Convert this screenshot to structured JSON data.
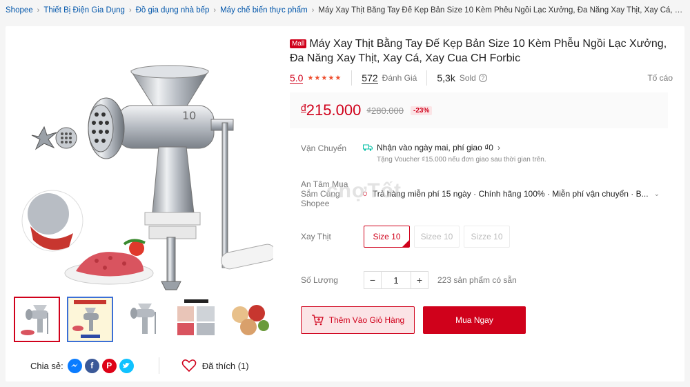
{
  "breadcrumb": {
    "items": [
      "Shopee",
      "Thiết Bị Điện Gia Dụng",
      "Đồ gia dụng nhà bếp",
      "Máy chế biến thực phẩm"
    ],
    "current": "Máy Xay Thịt Bằng Tay Đế Kẹp Bản Size 10 Kèm Phễu Ngồi Lạc Xưởng, Đa Năng Xay Thịt, Xay Cá, Xay ..."
  },
  "product": {
    "badge": "Mall",
    "title": "Máy Xay Thịt Bằng Tay Đế Kẹp Bản Size 10 Kèm Phễu Ngồi Lạc Xưởng, Đa Năng Xay Thịt, Xay Cá, Xay Cua CH Forbic",
    "rating": "5.0",
    "stars": "★★★★★",
    "reviews_count": "572",
    "reviews_label": "Đánh Giá",
    "sold_count": "5,3k",
    "sold_label": "Sold",
    "report_label": "Tố cáo",
    "currency": "đ",
    "price": "215.000",
    "old_price": "₫280.000",
    "discount": "-23%"
  },
  "shipping": {
    "label": "Vận Chuyển",
    "main": "Nhận vào ngày mai, phí giao ₫0",
    "sub": "Tặng Voucher ₫15.000 nếu đơn giao sau thời gian trên."
  },
  "assurance": {
    "label_line1": "An Tâm Mua",
    "label_line2": "Sắm Cùng",
    "label_line3": "Shopee",
    "text": "Trả hàng miễn phí 15 ngày · Chính hãng 100% · Miễn phí vận chuyển · B...",
    "watermark": "chợTốt"
  },
  "variants": {
    "label": "Xay Thịt",
    "options": [
      "Size 10",
      "Sizee 10",
      "Sizze 10"
    ]
  },
  "quantity": {
    "label": "Số Lượng",
    "value": "1",
    "minus": "−",
    "plus": "+",
    "stock": "223 sản phẩm có sẵn"
  },
  "actions": {
    "add_to_cart": "Thêm Vào Giỏ Hàng",
    "buy_now": "Mua Ngay"
  },
  "share": {
    "label": "Chia sẻ:",
    "like_label": "Đã thích (1)"
  },
  "colors": {
    "brand_red": "#d0011b",
    "link_blue": "#0055aa"
  }
}
